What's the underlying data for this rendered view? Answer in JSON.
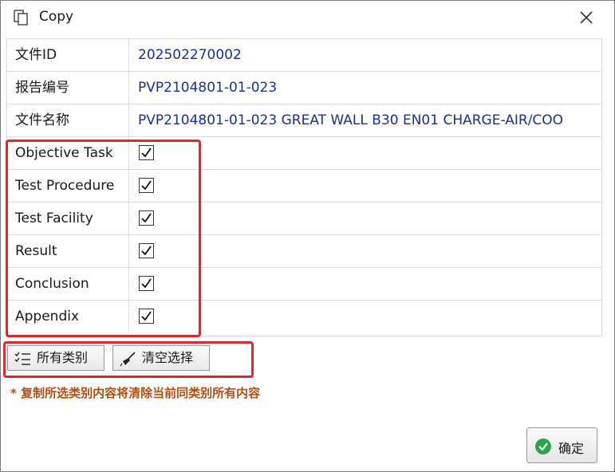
{
  "window": {
    "title": "Copy",
    "close_icon": "close-icon",
    "title_icon": "copy-icon"
  },
  "info_rows": [
    {
      "label": "文件ID",
      "value": "202502270002"
    },
    {
      "label": "报告编号",
      "value": "PVP2104801-01-023"
    },
    {
      "label": "文件名称",
      "value": "PVP2104801-01-023 GREAT WALL B30 EN01 CHARGE-AIR/COO"
    }
  ],
  "categories": [
    {
      "label": "Objective Task",
      "checked": true
    },
    {
      "label": "Test Procedure",
      "checked": true
    },
    {
      "label": "Test Facility",
      "checked": true
    },
    {
      "label": "Result",
      "checked": true
    },
    {
      "label": "Conclusion",
      "checked": true
    },
    {
      "label": "Appendix",
      "checked": true
    }
  ],
  "toolbar": {
    "select_all_label": "所有类别",
    "select_all_icon": "checklist-icon",
    "clear_label": "清空选择",
    "clear_icon": "broom-icon"
  },
  "note": "* 复制所选类别内容将清除当前同类别所有内容",
  "footer": {
    "ok_label": "确定",
    "ok_icon": "check-circle-icon"
  },
  "colors": {
    "value_text": "#1f2f8a",
    "note_text": "#b34d10",
    "highlight": "#e8232a",
    "ok_icon": "#2ea44f"
  }
}
